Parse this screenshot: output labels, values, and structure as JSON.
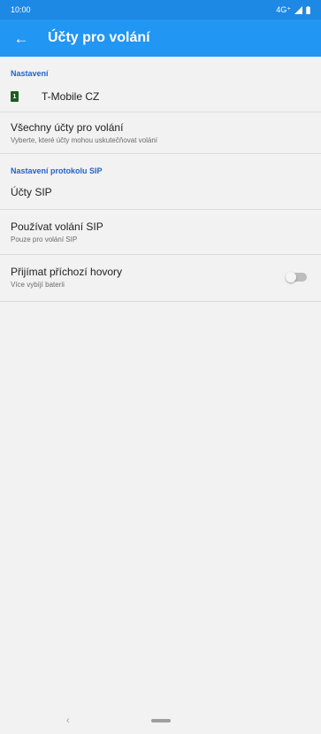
{
  "status_bar": {
    "time": "10:00",
    "network": "4G⁺"
  },
  "app_bar": {
    "title": "Účty pro volání"
  },
  "sections": {
    "settings_header": "Nastavení",
    "sim_label": "T-Mobile CZ",
    "all_accounts": {
      "title": "Všechny účty pro volání",
      "subtitle": "Vyberte, které účty mohou uskutečňovat volání"
    },
    "sip_header": "Nastavení protokolu SIP",
    "sip_accounts": {
      "title": "Účty SIP"
    },
    "use_sip": {
      "title": "Používat volání SIP",
      "subtitle": "Pouze pro volání SIP"
    },
    "incoming": {
      "title": "Přijímat příchozí hovory",
      "subtitle": "Více vybíjí baterii",
      "toggle_on": false
    }
  },
  "colors": {
    "app_bar": "#2196f3",
    "status_bar": "#1e88e5",
    "accent": "#2563c9",
    "sim": "#1b5e20"
  }
}
